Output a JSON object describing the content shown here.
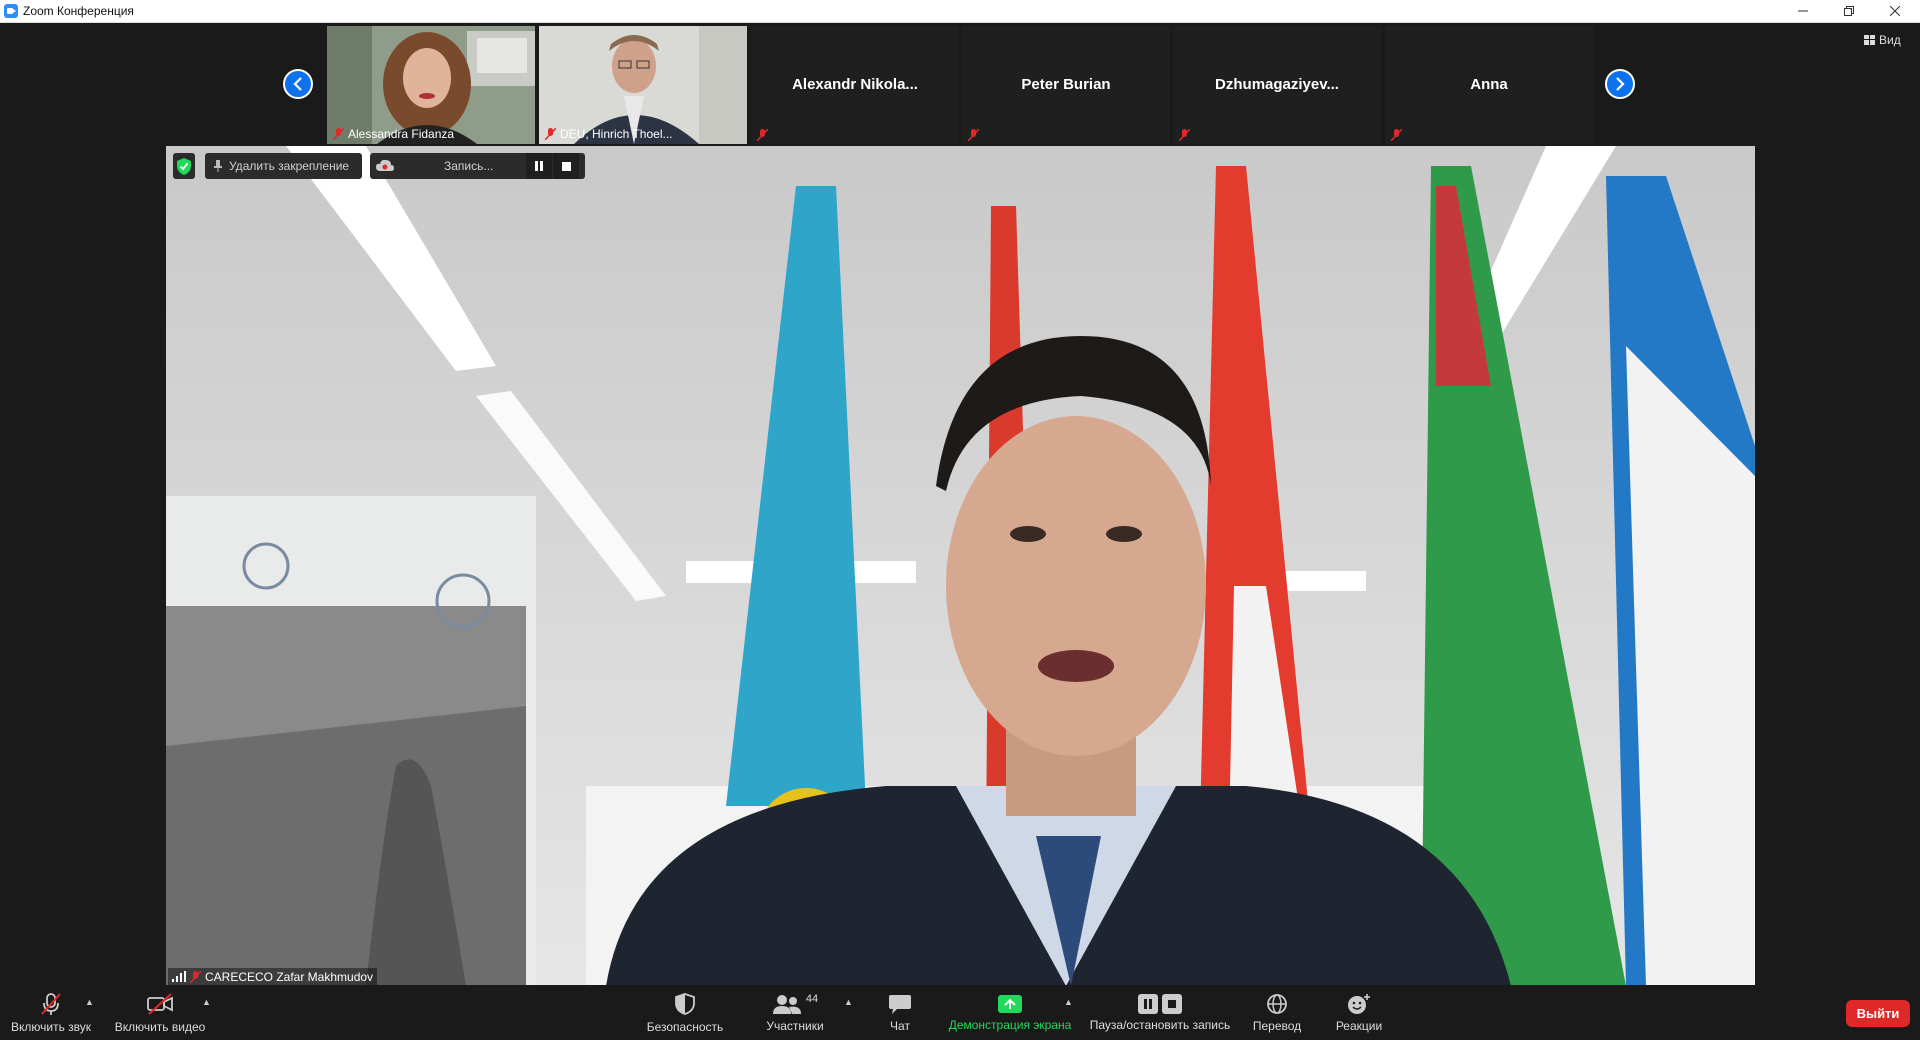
{
  "window": {
    "title": "Zoom Конференция"
  },
  "gallery": {
    "tiles": [
      {
        "name": "Alessandra Fidanza"
      },
      {
        "name": "DEU, Hinrich Thoel..."
      },
      {
        "name": "Alexandr  Nikola..."
      },
      {
        "name": "Peter Burian"
      },
      {
        "name": "Dzhumagaziyev..."
      },
      {
        "name": "Anna"
      }
    ],
    "view_label": "Вид"
  },
  "main": {
    "unpin_label": "Удалить закрепление",
    "recording_label": "Запись...",
    "speaker_name": "CARECECO Zafar Makhmudov"
  },
  "toolbar": {
    "unmute_label": "Включить звук",
    "start_video_label": "Включить видео",
    "security_label": "Безопасность",
    "participants_label": "Участники",
    "participants_count": "44",
    "chat_label": "Чат",
    "share_label": "Демонстрация экрана",
    "record_label": "Пауза/остановить запись",
    "translate_label": "Перевод",
    "reactions_label": "Реакции",
    "leave_label": "Выйти"
  },
  "colors": {
    "accent": "#0e72ed",
    "share_green": "#23d959",
    "leave_red": "#e02828",
    "muted_red": "#e02828"
  }
}
